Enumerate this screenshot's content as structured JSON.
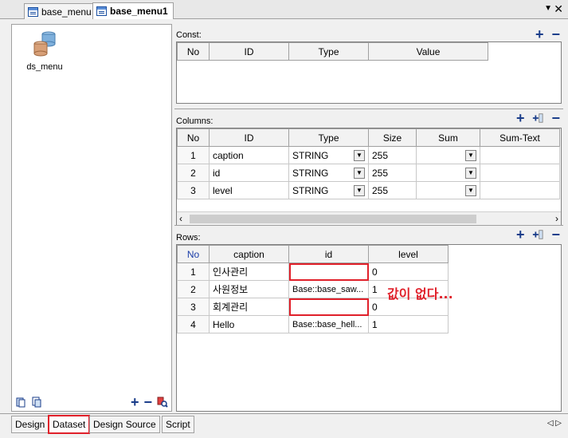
{
  "tabs": [
    {
      "label": "base_menu",
      "active": false
    },
    {
      "label": "base_menu1",
      "active": true
    }
  ],
  "left": {
    "dataset_label": "ds_menu"
  },
  "const": {
    "title": "Const:",
    "headers": [
      "No",
      "ID",
      "Type",
      "Value"
    ]
  },
  "columns": {
    "title": "Columns:",
    "headers": [
      "No",
      "ID",
      "Type",
      "Size",
      "Sum",
      "Sum-Text"
    ],
    "rows": [
      {
        "no": "1",
        "id": "caption",
        "type": "STRING",
        "size": "255"
      },
      {
        "no": "2",
        "id": "id",
        "type": "STRING",
        "size": "255"
      },
      {
        "no": "3",
        "id": "level",
        "type": "STRING",
        "size": "255"
      }
    ]
  },
  "rows": {
    "title": "Rows:",
    "headers": [
      "No",
      "caption",
      "id",
      "level"
    ],
    "data": [
      {
        "no": "1",
        "caption": "인사관리",
        "id": "",
        "level": "0"
      },
      {
        "no": "2",
        "caption": "사원정보",
        "id": "Base::base_saw...",
        "level": "1"
      },
      {
        "no": "3",
        "caption": "회계관리",
        "id": "",
        "level": "0"
      },
      {
        "no": "4",
        "caption": "Hello",
        "id": "Base::base_hell...",
        "level": "1"
      }
    ]
  },
  "annotation": "값이 없다...",
  "bottom_tabs": [
    "Design",
    "Dataset",
    "Design Source",
    "Script"
  ],
  "colors": {
    "highlight": "#e0202a",
    "accent": "#1a3da8"
  }
}
